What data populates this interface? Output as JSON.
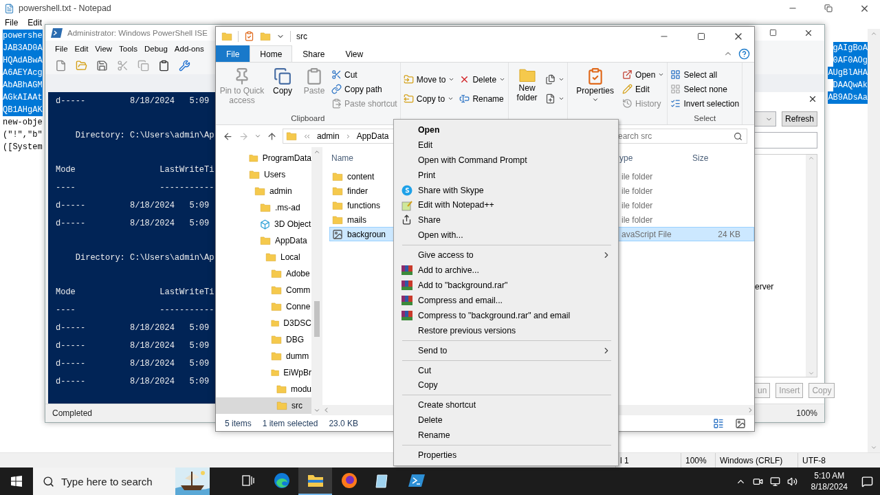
{
  "notepad": {
    "title": "powershell.txt - Notepad",
    "menu": [
      "File",
      "Edit"
    ],
    "lines": [
      {
        "left": "powershe",
        "selected": true
      },
      {
        "left": "JAB3AD0A",
        "right": "gAIgBoA",
        "selected": true
      },
      {
        "left": "HQAdABwA",
        "right": "0AF0AOg",
        "selected": true
      },
      {
        "left": "A6AEYAcg",
        "right": "AUgBlAHA",
        "selected": true
      },
      {
        "left": "AbABhAGM",
        "right": "DAAQwAk",
        "selected": true
      },
      {
        "left": "AGkAIAAt",
        "right": "AB9ADsAa",
        "selected": true
      },
      {
        "left": "QB1AHgAK",
        "selected": true
      },
      {
        "left": "new-obje",
        "selected": false
      },
      {
        "left": "(\"!\",\"b\"",
        "selected": false
      },
      {
        "left": "([System",
        "selected": false
      }
    ],
    "status": [
      "l 1",
      "100%",
      "Windows (CRLF)",
      "UTF-8"
    ]
  },
  "ise": {
    "title": "Administrator: Windows PowerShell ISE",
    "menu": [
      "File",
      "Edit",
      "View",
      "Tools",
      "Debug",
      "Add-ons"
    ],
    "console": [
      [
        "d-----         8/18/2024   5:09"
      ],
      [
        "    Directory: C:\\Users\\admin\\Ap"
      ],
      [
        "Mode                 LastWriteTi",
        "----                 -----------",
        "d-----         8/18/2024   5:09",
        "d-----         8/18/2024   5:09"
      ],
      [
        "    Directory: C:\\Users\\admin\\Ap"
      ],
      [
        "Mode                 LastWriteTi",
        "----                 -----------",
        "d-----         8/18/2024   5:09",
        "d-----         8/18/2024   5:09",
        "d-----         8/18/2024   5:09",
        "d-----         8/18/2024   5:09"
      ]
    ],
    "commands": {
      "refresh": "Refresh",
      "list_text": "erver",
      "buttons": [
        "un",
        "Insert",
        "Copy"
      ]
    },
    "status": "Completed",
    "zoom": "100%"
  },
  "explorer": {
    "title": "src",
    "tabs": [
      {
        "label": "File",
        "kind": "file",
        "selected": false
      },
      {
        "label": "Home",
        "kind": "tab",
        "selected": true
      },
      {
        "label": "Share",
        "kind": "tab",
        "selected": false
      },
      {
        "label": "View",
        "kind": "tab",
        "selected": false
      }
    ],
    "ribbon": [
      {
        "label": "Clipboard",
        "commands": [
          {
            "label": "Pin to Quick access",
            "kind": "large",
            "disabled": true,
            "dropdown": false
          },
          {
            "label": "Copy",
            "kind": "large",
            "disabled": false,
            "dropdown": false
          },
          {
            "label": "Paste",
            "kind": "large",
            "disabled": true,
            "dropdown": false
          },
          {
            "label": "Cut",
            "kind": "small",
            "disabled": false,
            "dropdown": false
          },
          {
            "label": "Copy path",
            "kind": "small",
            "disabled": false,
            "dropdown": false
          },
          {
            "label": "Paste shortcut",
            "kind": "small",
            "disabled": true,
            "dropdown": false
          }
        ]
      },
      {
        "commands": [
          {
            "label": "Move to",
            "kind": "small",
            "disabled": false,
            "dropdown": true
          },
          {
            "label": "Copy to",
            "kind": "small",
            "disabled": false,
            "dropdown": true
          },
          {
            "label": "Delete",
            "kind": "small",
            "disabled": false,
            "dropdown": true
          },
          {
            "label": "Rename",
            "kind": "small",
            "disabled": false,
            "dropdown": false
          }
        ]
      },
      {
        "commands": [
          {
            "label": "New folder",
            "kind": "large",
            "disabled": false,
            "dropdown": false
          },
          {
            "kind": "icon",
            "disabled": false,
            "dropdown": true
          },
          {
            "kind": "icon",
            "disabled": false,
            "dropdown": true
          }
        ]
      },
      {
        "commands": [
          {
            "label": "Properties",
            "kind": "large",
            "disabled": false,
            "dropdown": true
          },
          {
            "label": "Open",
            "kind": "small",
            "disabled": false,
            "dropdown": true
          },
          {
            "label": "Edit",
            "kind": "small",
            "disabled": false,
            "dropdown": false
          },
          {
            "label": "History",
            "kind": "small",
            "disabled": true,
            "dropdown": false
          }
        ]
      },
      {
        "label": "Select",
        "commands": [
          {
            "label": "Select all",
            "kind": "small",
            "disabled": false,
            "dropdown": false
          },
          {
            "label": "Select none",
            "kind": "small",
            "disabled": false,
            "dropdown": false
          },
          {
            "label": "Invert selection",
            "kind": "small",
            "disabled": false,
            "dropdown": false
          }
        ]
      }
    ],
    "address": [
      "admin",
      "AppData"
    ],
    "search_placeholder": "earch src",
    "tree": [
      {
        "label": "ProgramData",
        "kind": "folder",
        "selected": false
      },
      {
        "label": "Users",
        "kind": "folder",
        "selected": false,
        "children": [
          {
            "label": "admin",
            "kind": "folder",
            "selected": false,
            "children": [
              {
                "label": ".ms-ad",
                "kind": "folder",
                "selected": false
              },
              {
                "label": "3D Object",
                "kind": "cube",
                "selected": false
              },
              {
                "label": "AppData",
                "kind": "folder",
                "selected": false,
                "children": [
                  {
                    "label": "Local",
                    "kind": "folder",
                    "selected": false,
                    "children": [
                      {
                        "label": "Adobe",
                        "kind": "folder",
                        "selected": false
                      },
                      {
                        "label": "Comm",
                        "kind": "folder",
                        "selected": false
                      },
                      {
                        "label": "Conne",
                        "kind": "folder",
                        "selected": false
                      },
                      {
                        "label": "D3DSC",
                        "kind": "folder",
                        "selected": false
                      },
                      {
                        "label": "DBG",
                        "kind": "folder",
                        "selected": false
                      },
                      {
                        "label": "dumm",
                        "kind": "folder",
                        "selected": false
                      },
                      {
                        "label": "EiWpBr",
                        "kind": "folder",
                        "selected": false,
                        "children": [
                          {
                            "label": "modu",
                            "kind": "folder",
                            "selected": false
                          },
                          {
                            "label": "src",
                            "kind": "folder",
                            "selected": true
                          }
                        ]
                      }
                    ]
                  }
                ]
              }
            ]
          }
        ]
      }
    ],
    "columns": [
      "Name",
      "ype",
      "Size"
    ],
    "files": [
      {
        "name": "content",
        "kind": "folder",
        "type": "ile folder",
        "selected": false
      },
      {
        "name": "finder",
        "kind": "folder",
        "type": "ile folder",
        "selected": false
      },
      {
        "name": "functions",
        "kind": "folder",
        "type": "ile folder",
        "selected": false
      },
      {
        "name": "mails",
        "kind": "folder",
        "type": "ile folder",
        "selected": false
      },
      {
        "name": "backgroun",
        "kind": "script",
        "type": "avaScript File",
        "size": "24 KB",
        "selected": true
      }
    ],
    "status": [
      "5 items",
      "1 item selected",
      "23.0 KB"
    ]
  },
  "context_menu": [
    [
      {
        "label": "Open",
        "kind": "plain",
        "default": true
      },
      {
        "label": "Edit",
        "kind": "plain",
        "default": false
      },
      {
        "label": "Open with Command Prompt",
        "kind": "plain",
        "default": false
      },
      {
        "label": "Print",
        "kind": "plain",
        "default": false
      },
      {
        "label": "Share with Skype",
        "kind": "skype",
        "default": false
      },
      {
        "label": "Edit with Notepad++",
        "kind": "notepad",
        "default": false
      },
      {
        "label": "Share",
        "kind": "share",
        "default": false
      },
      {
        "label": "Open with...",
        "kind": "plain",
        "default": false
      }
    ],
    [
      {
        "label": "Give access to",
        "kind": "submenu",
        "default": false
      },
      {
        "label": "Add to archive...",
        "kind": "archive",
        "default": false
      },
      {
        "label": "Add to \"background.rar\"",
        "kind": "archive",
        "default": false
      },
      {
        "label": "Compress and email...",
        "kind": "archive",
        "default": false
      },
      {
        "label": "Compress to \"background.rar\" and email",
        "kind": "archive",
        "default": false
      },
      {
        "label": "Restore previous versions",
        "kind": "plain",
        "default": false
      }
    ],
    [
      {
        "label": "Send to",
        "kind": "submenu",
        "default": false
      }
    ],
    [
      {
        "label": "Cut",
        "kind": "plain",
        "default": false
      },
      {
        "label": "Copy",
        "kind": "plain",
        "default": false
      }
    ],
    [
      {
        "label": "Create shortcut",
        "kind": "plain",
        "default": false
      },
      {
        "label": "Delete",
        "kind": "plain",
        "default": false
      },
      {
        "label": "Rename",
        "kind": "plain",
        "default": false
      }
    ],
    [
      {
        "label": "Properties",
        "kind": "plain",
        "default": false
      }
    ]
  ],
  "taskbar": {
    "search_placeholder": "Type here to search",
    "apps": [
      {
        "kind": "taskview",
        "selected": false
      },
      {
        "kind": "edge",
        "selected": false
      },
      {
        "kind": "explorer",
        "selected": true
      },
      {
        "kind": "firefox",
        "selected": false
      },
      {
        "kind": "notepad",
        "selected": false
      },
      {
        "kind": "powershell",
        "selected": false
      }
    ],
    "time": "5:10 AM",
    "date": "8/18/2024"
  }
}
